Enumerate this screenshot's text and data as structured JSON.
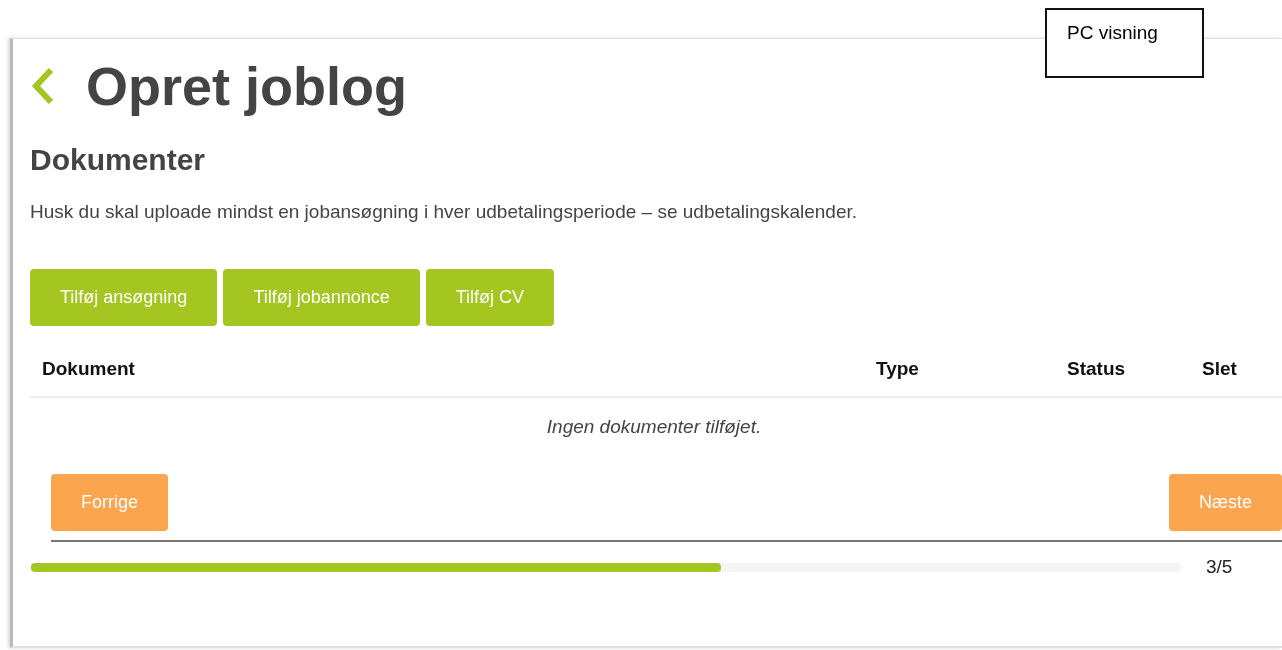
{
  "annotation": {
    "text": "PC visning"
  },
  "page": {
    "title": "Opret joblog"
  },
  "section": {
    "heading": "Dokumenter",
    "note": "Husk du skal uploade mindst en jobansøgning i hver udbetalingsperiode – se udbetalingskalender."
  },
  "buttons": [
    "Tilføj ansøgning",
    "Tilføj jobannonce",
    "Tilføj CV"
  ],
  "table": {
    "columns": [
      "Dokument",
      "Type",
      "Status",
      "Slet"
    ],
    "empty_message": "Ingen dokumenter tilføjet."
  },
  "navigation": {
    "previous": "Forrige",
    "next": "Næste"
  },
  "progress": {
    "level": 0.6,
    "reading": "3/5"
  }
}
